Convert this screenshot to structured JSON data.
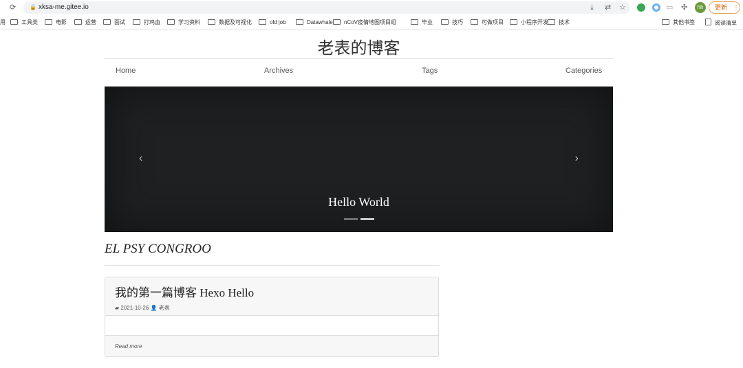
{
  "browser": {
    "url": "xksa-me.gitee.io",
    "update_label": "更新",
    "avatar": "hh",
    "bookmarks": [
      "用",
      "工具类",
      "电影",
      "运营",
      "面试",
      "打鸡血",
      "学习资料",
      "数据及可视化",
      "old job",
      "Datawhale",
      "nCoV疫情地图项目组",
      "毕业",
      "技巧",
      "可做项目",
      "小程序开发",
      "技术"
    ],
    "other_bookmarks": "其他书签",
    "reading_list": "阅读清单"
  },
  "site": {
    "title": "老表的博客",
    "nav": [
      "Home",
      "Archives",
      "Tags",
      "Categories"
    ]
  },
  "carousel": {
    "caption": "Hello World",
    "slides": 2,
    "active_slide": 2
  },
  "subtitle": "EL PSY CONGROO",
  "post": {
    "title": "我的第一篇博客 Hexo Hello",
    "date": "2021-10-26",
    "author": "老表",
    "read_more": "Read more"
  }
}
